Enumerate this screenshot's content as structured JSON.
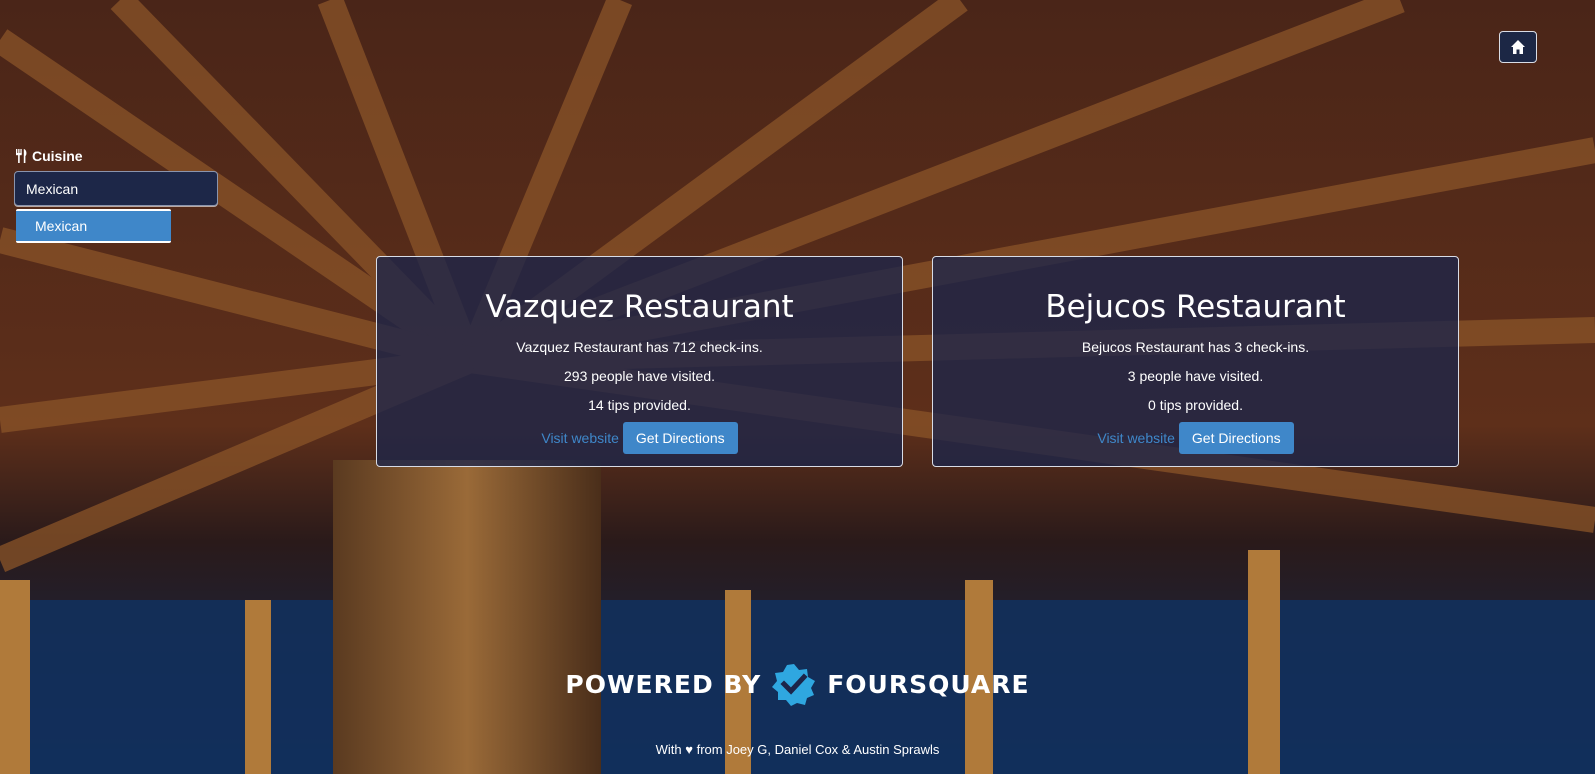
{
  "header": {
    "home_icon": "home-icon"
  },
  "search": {
    "label": "Cuisine",
    "label_icon": "utensils-icon",
    "value": "Mexican",
    "suggestions": [
      "Mexican"
    ]
  },
  "results": [
    {
      "name": "Vazquez Restaurant",
      "checkins": "Vazquez Restaurant has 712 check-ins.",
      "visitors": "293 people have visited.",
      "tips": "14 tips provided.",
      "visit_label": "Visit website",
      "directions_label": "Get Directions"
    },
    {
      "name": "Bejucos Restaurant",
      "checkins": "Bejucos Restaurant has 3 check-ins.",
      "visitors": "3 people have visited.",
      "tips": "0 tips provided.",
      "visit_label": "Visit website",
      "directions_label": "Get Directions"
    }
  ],
  "footer": {
    "powered_prefix": "POWERED BY",
    "powered_brand": "FOURSQUARE",
    "brand_icon": "foursquare-logo-icon",
    "credits": "With ♥ from Joey G, Daniel Cox & Austin Sprawls"
  },
  "colors": {
    "accent": "#3f87c9",
    "card_bg": "#1c254a",
    "brand": "#2fa7e0"
  }
}
